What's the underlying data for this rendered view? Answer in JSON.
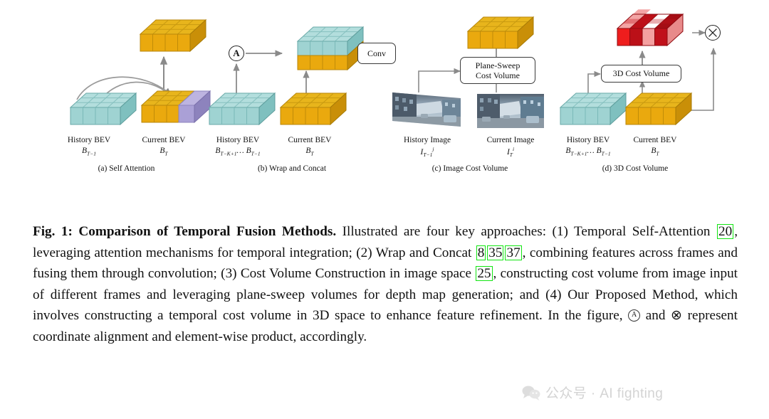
{
  "figure": {
    "panels": [
      {
        "id": "a",
        "caption": "(a) Self Attention",
        "nodes": [
          {
            "name": "history-bev",
            "label": "History BEV",
            "sublabel": "B",
            "sub": "T−1",
            "sup": ""
          },
          {
            "name": "current-bev",
            "label": "Current BEV",
            "sublabel": "B",
            "sub": "T",
            "sup": ""
          }
        ]
      },
      {
        "id": "b",
        "caption": "(b) Wrap and Concat",
        "op_label": "A",
        "process_box": "Conv",
        "nodes": [
          {
            "name": "history-bev",
            "label": "History BEV",
            "sublabel": "B",
            "sub": "T−K+1",
            "tail": "… B",
            "tail_sub": "T−1"
          },
          {
            "name": "current-bev",
            "label": "Current BEV",
            "sublabel": "B",
            "sub": "T"
          }
        ]
      },
      {
        "id": "c",
        "caption": "(c) Image Cost Volume",
        "process_box_line1": "Plane-Sweep",
        "process_box_line2": "Cost Volume",
        "nodes": [
          {
            "name": "history-image",
            "label": "History Image",
            "sublabel": "I",
            "sub": "T−1",
            "sup": "j"
          },
          {
            "name": "current-image",
            "label": "Current Image",
            "sublabel": "I",
            "sub": "T",
            "sup": "i"
          }
        ]
      },
      {
        "id": "d",
        "caption": "(d) 3D Cost Volume",
        "process_box": "3D Cost Volume",
        "op_label": "⊗",
        "nodes": [
          {
            "name": "history-bev",
            "label": "History BEV",
            "sublabel": "B",
            "sub": "T−K+1",
            "tail": "… B",
            "tail_sub": "T−1"
          },
          {
            "name": "current-bev",
            "label": "Current BEV",
            "sublabel": "B",
            "sub": "T"
          }
        ]
      }
    ],
    "colors": {
      "teal_top": "#b3dedd",
      "teal_front": "#9fd3d2",
      "teal_side": "#7fc0bf",
      "gold_top": "#e8b51c",
      "gold_front": "#eaa90e",
      "gold_side": "#c98f08",
      "purple_top": "#bdb4e0",
      "purple_front": "#aaa0d6",
      "purple_side": "#8d83bd",
      "red_dark": "#c0101a",
      "red_bright": "#ee1d1d",
      "red_light": "#f4a0a0",
      "arrow": "#8a8a8a",
      "cite_box": "#12e512"
    }
  },
  "caption": {
    "lead": "Fig. 1: Comparison of Temporal Fusion Methods.",
    "t1": " Illustrated are four key approaches: (1) Temporal Self-Attention ",
    "c1": "20",
    "t2": ", leveraging attention mechanisms for temporal integration; (2) Wrap and Concat ",
    "c2": "8",
    "c2b": "35",
    "c2c": "37",
    "t3": ", combining features across frames and fusing them through convolution; (3) Cost Volume Construction in image space ",
    "c3": "25",
    "t4": ", constructing cost volume from image input of different frames and leveraging plane-sweep volumes for depth map generation; and (4) Our Proposed Method, which involves constructing a temporal cost volume in 3D space to enhance feature refinement. In the figure, ",
    "op_a": "A",
    "t5": " and ",
    "op_times": "⊗",
    "t6": " represent coordinate alignment and element-wise product, accordingly."
  },
  "watermark": {
    "text": "公众号 · AI fighting",
    "icon": "wechat-icon"
  }
}
